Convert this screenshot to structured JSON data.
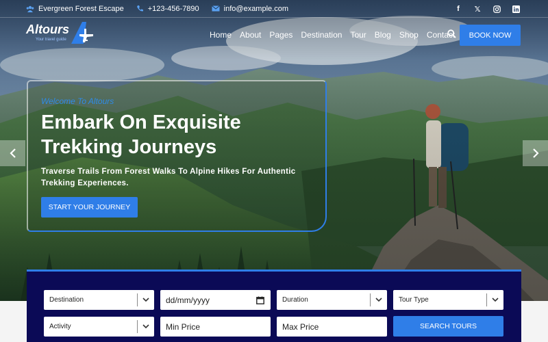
{
  "topbar": {
    "location": "Evergreen Forest Escape",
    "phone": "+123-456-7890",
    "email": "info@example.com",
    "socials": [
      "facebook-icon",
      "x-icon",
      "instagram-icon",
      "linkedin-icon"
    ]
  },
  "brand": {
    "name": "Altours",
    "tagline": "Your travel guide"
  },
  "nav": {
    "items": [
      "Home",
      "About",
      "Pages",
      "Destination",
      "Tour",
      "Blog",
      "Shop",
      "Contact"
    ],
    "book_label": "BOOK NOW"
  },
  "hero": {
    "welcome": "Welcome To Altours",
    "headline_line1": "Embark On Exquisite",
    "headline_line2": "Trekking Journeys",
    "subtext_line1": "Traverse Trails From Forest Walks To Alpine Hikes For Authentic",
    "subtext_line2": "Trekking Experiences.",
    "cta_label": "START YOUR JOURNEY"
  },
  "search": {
    "destination": "Destination",
    "date_placeholder": "dd/mm/yyyy",
    "duration": "Duration",
    "tour_type": "Tour Type",
    "activity": "Activity",
    "min_price": "Min Price",
    "max_price": "Max Price",
    "submit_label": "SEARCH TOURS"
  },
  "colors": {
    "accent": "#2f7ee8",
    "panel": "#0b0a56"
  }
}
